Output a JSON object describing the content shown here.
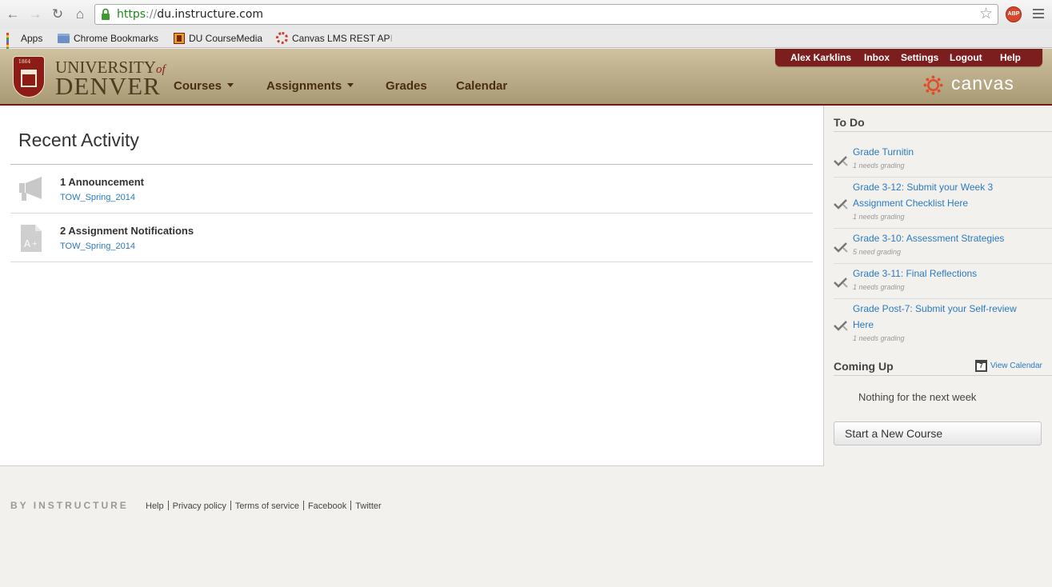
{
  "browser": {
    "url_scheme": "https",
    "url_sep": "://",
    "url_host": "du.instructure.com",
    "abp_label": "ABP",
    "bookmarks": [
      {
        "label": "Apps"
      },
      {
        "label": "Chrome Bookmarks"
      },
      {
        "label": "DU CourseMedia"
      },
      {
        "label": "Canvas LMS REST AP",
        "fade": "I"
      }
    ]
  },
  "header": {
    "logo": {
      "year": "1864",
      "univ": "UNIVERSITY",
      "of": "of",
      "denver": "DENVER"
    },
    "nav": [
      {
        "label": "Courses"
      },
      {
        "label": "Assignments"
      },
      {
        "label": "Grades"
      },
      {
        "label": "Calendar"
      }
    ],
    "user_menu": [
      {
        "label": "Alex Karklins"
      },
      {
        "label": "Inbox"
      },
      {
        "label": "Settings"
      },
      {
        "label": "Logout"
      },
      {
        "label": "Help"
      }
    ],
    "brand": "canvas",
    "colors": {
      "accent": "#7c1e1e",
      "header_bg": "#b8a984",
      "link": "#2a7abf"
    }
  },
  "main": {
    "title": "Recent Activity",
    "activities": [
      {
        "title": "1 Announcement",
        "course": "TOW_Spring_2014",
        "icon": "megaphone-icon"
      },
      {
        "title": "2 Assignment Notifications",
        "course": "TOW_Spring_2014",
        "icon": "assignment-icon"
      }
    ]
  },
  "sidebar": {
    "todo_heading": "To Do",
    "todos": [
      {
        "line1": "Grade Turnitin",
        "line2": "",
        "sub": "1 needs grading"
      },
      {
        "line1": "Grade 3-12: Submit your Week 3",
        "line2": "Assignment Checklist Here",
        "sub": "1 needs grading"
      },
      {
        "line1": "Grade 3-10: Assessment Strategies",
        "line2": "",
        "sub": "5 need grading"
      },
      {
        "line1": "Grade 3-11: Final Reflections",
        "line2": "",
        "sub": "1 needs grading"
      },
      {
        "line1": "Grade Post-7: Submit your Self-review",
        "line2": "Here",
        "sub": "1 needs grading"
      }
    ],
    "close_glyph": "×",
    "coming_up_heading": "Coming Up",
    "calendar_icon_day": "7",
    "view_calendar": "View Calendar",
    "nothing": "Nothing for the next week",
    "new_course_button": "Start a New Course"
  },
  "footer": {
    "brand": "BY INSTRUCTURE",
    "links": [
      "Help",
      "Privacy policy",
      "Terms of service",
      "Facebook",
      "Twitter"
    ]
  }
}
